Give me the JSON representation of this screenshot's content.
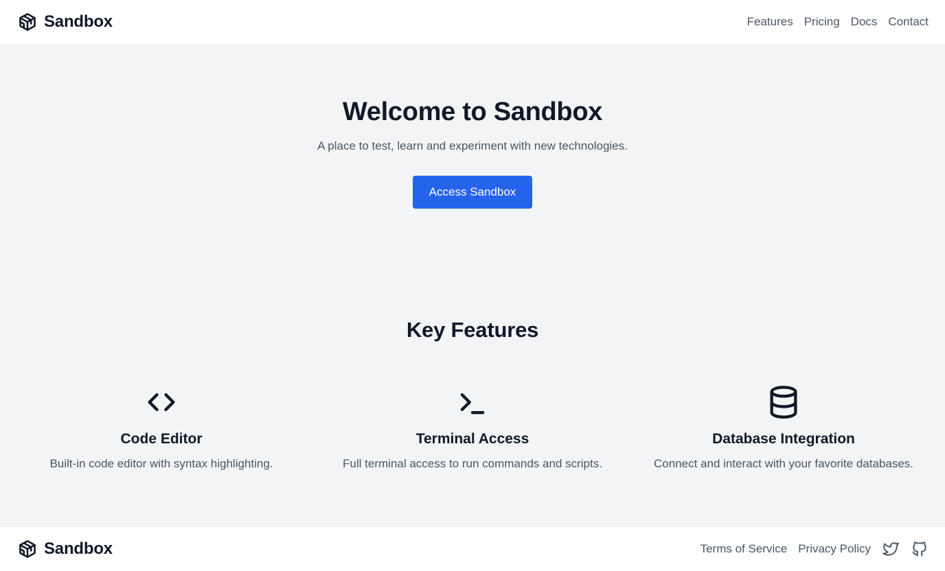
{
  "header": {
    "brand": "Sandbox",
    "logo_icon": "cube-icon",
    "nav": [
      {
        "label": "Features"
      },
      {
        "label": "Pricing"
      },
      {
        "label": "Docs"
      },
      {
        "label": "Contact"
      }
    ]
  },
  "hero": {
    "title": "Welcome to Sandbox",
    "subtitle": "A place to test, learn and experiment with new technologies.",
    "cta_label": "Access Sandbox"
  },
  "features": {
    "title": "Key Features",
    "items": [
      {
        "icon": "code-icon",
        "title": "Code Editor",
        "description": "Built-in code editor with syntax highlighting."
      },
      {
        "icon": "terminal-icon",
        "title": "Terminal Access",
        "description": "Full terminal access to run commands and scripts."
      },
      {
        "icon": "database-icon",
        "title": "Database Integration",
        "description": "Connect and interact with your favorite databases."
      }
    ]
  },
  "footer": {
    "brand": "Sandbox",
    "links": [
      {
        "label": "Terms of Service"
      },
      {
        "label": "Privacy Policy"
      }
    ],
    "social_icons": [
      "twitter-icon",
      "github-icon"
    ]
  },
  "colors": {
    "accent": "#2563eb",
    "background": "#f3f4f6",
    "text": "#111827",
    "muted_text": "#4b5563"
  }
}
